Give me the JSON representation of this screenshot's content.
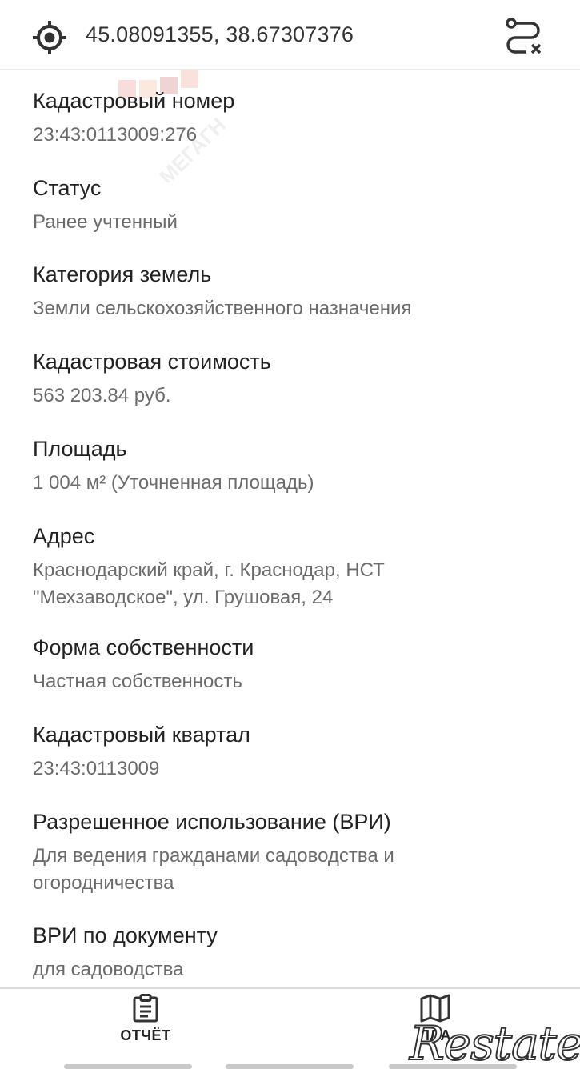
{
  "header": {
    "coordinates": "45.08091355, 38.67307376",
    "location_icon": "target-icon",
    "route_icon": "route-clear-icon"
  },
  "watermark": {
    "text": "МЕГАГН"
  },
  "fields": [
    {
      "label": "Кадастровый номер",
      "value": "23:43:0113009:276"
    },
    {
      "label": "Статус",
      "value": "Ранее учтенный"
    },
    {
      "label": "Категория земель",
      "value": "Земли сельскохозяйственного назначения"
    },
    {
      "label": "Кадастровая стоимость",
      "value": "563 203.84 руб."
    },
    {
      "label": "Площадь",
      "value": "1 004 м² (Уточненная площадь)"
    },
    {
      "label": "Адрес",
      "value_line1": "Краснодарский край, г. Краснодар, НСТ",
      "value_line2": "\"Мехзаводское\", ул. Грушовая, 24"
    },
    {
      "label": "Форма собственности",
      "value": "Частная собственность"
    },
    {
      "label": "Кадастровый квартал",
      "value": "23:43:0113009"
    },
    {
      "label": "Разрешенное использование (ВРИ)",
      "value_line1": "Для ведения гражданами садоводства и",
      "value_line2": "огородничества"
    },
    {
      "label": "ВРИ по документу",
      "value": "для садоводства"
    }
  ],
  "bottom_nav": {
    "report": {
      "label": "ОТЧЁТ",
      "icon": "clipboard-icon"
    },
    "map": {
      "label": "ПЛА",
      "icon": "map-icon"
    }
  },
  "brand_overlay": {
    "text": "Restate"
  },
  "colors": {
    "label": "#222222",
    "value": "#6b6b6b",
    "divider": "#e8e8e8"
  }
}
